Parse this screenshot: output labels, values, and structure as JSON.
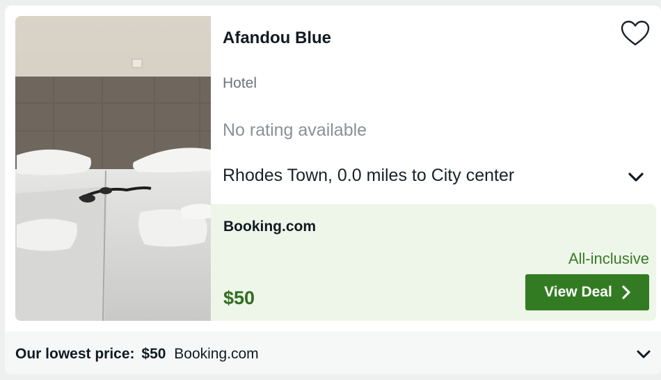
{
  "hotel": {
    "name": "Afandou Blue",
    "type": "Hotel",
    "rating_text": "No rating available",
    "location": "Rhodes Town, 0.0 miles to City center"
  },
  "deal": {
    "provider": "Booking.com",
    "board": "All-inclusive",
    "price": "$50",
    "button_label": "View Deal"
  },
  "lowest": {
    "label": "Our lowest price:",
    "price": "$50",
    "provider": "Booking.com"
  },
  "icons": {
    "favorite": "heart-outline-icon",
    "expand": "chevron-down-icon",
    "deal_arrow": "chevron-right-icon"
  },
  "colors": {
    "accent_green": "#337b22",
    "price_green": "#2f6e1f",
    "deal_background": "#eef6ea"
  }
}
